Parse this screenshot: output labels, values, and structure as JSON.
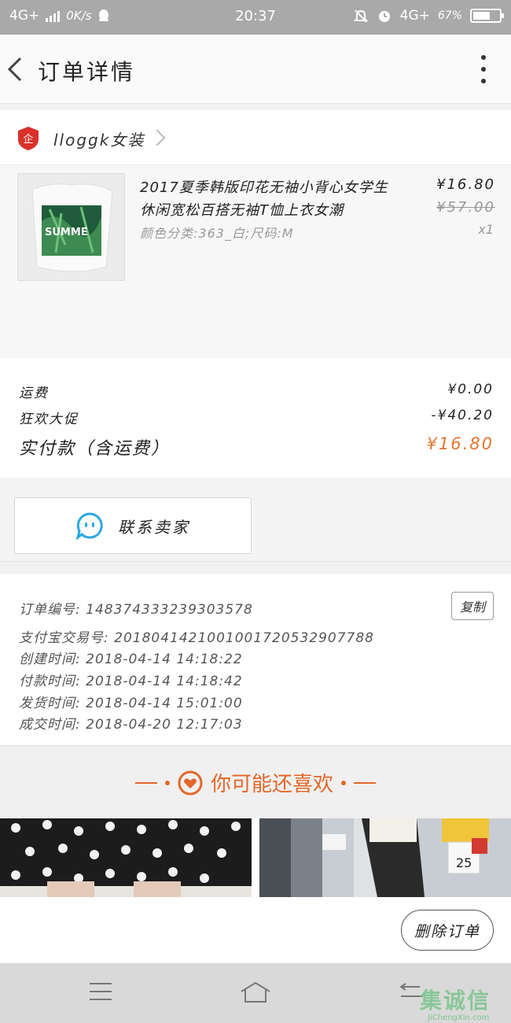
{
  "status_bar": {
    "network": "4G+",
    "speed": "0K/s",
    "time": "20:37",
    "network_right": "4G+",
    "battery": "67%",
    "battery_level": 0.67
  },
  "header": {
    "title": "订单详情"
  },
  "shop": {
    "name": "lloggk女装",
    "badge": "企"
  },
  "product": {
    "name": "2017夏季韩版印花无袖小背心女学生休闲宽松百搭无袖T恤上衣女潮",
    "sku": "颜色分类:363_白;尺码:M",
    "price": "¥16.80",
    "original_price": "¥57.00",
    "quantity": "x1",
    "thumb_text": "SUMME"
  },
  "totals": {
    "shipping_label": "运费",
    "shipping_value": "¥0.00",
    "promo_label": "狂欢大促",
    "promo_value": "-¥40.20",
    "paid_label": "实付款（含运费）",
    "paid_value": "¥16.80"
  },
  "contact": {
    "label": "联系卖家"
  },
  "order_info": {
    "order_no": "订单编号: 1483743332393035​78",
    "alipay_no": "支付宝交易号: 2018041421001001720532907788",
    "created": "创建时间: 2018-04-14  14:18:22",
    "paid": "付款时间: 2018-04-14  14:18:42",
    "shipped": "发货时间: 2018-04-14  15:01:00",
    "completed": "成交时间: 2018-04-20  12:17:03",
    "copy_label": "复制"
  },
  "recommend": {
    "title": "你可能还喜欢"
  },
  "actions": {
    "delete_label": "删除订单"
  },
  "watermark": {
    "text": "集诚信",
    "url": "JiChengXin.com"
  },
  "colors": {
    "accent": "#e4772f",
    "contact_icon": "#2aa7e6",
    "shop_badge": "#d9312b"
  }
}
